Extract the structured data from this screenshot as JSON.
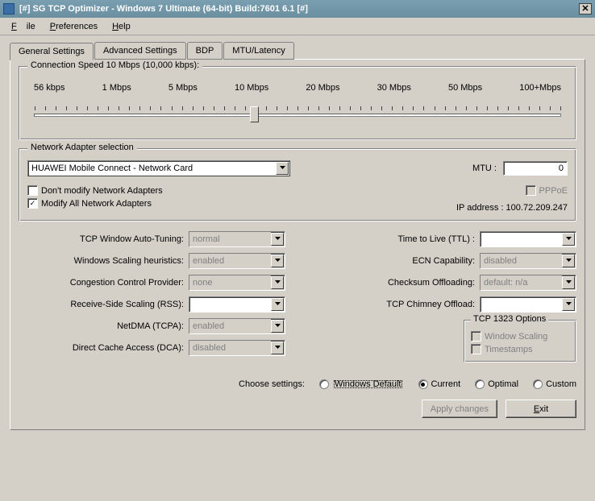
{
  "title": "[#] SG TCP Optimizer - Windows 7 Ultimate (64-bit) Build:7601 6.1  [#]",
  "menu": {
    "file": "File",
    "preferences": "Preferences",
    "help": "Help"
  },
  "tabs": {
    "general": "General Settings",
    "advanced": "Advanced Settings",
    "bdp": "BDP",
    "mtu": "MTU/Latency"
  },
  "connection": {
    "group_label": "Connection Speed  10 Mbps (10,000 kbps):",
    "ticks": [
      "56 kbps",
      "1 Mbps",
      "5 Mbps",
      "10 Mbps",
      "20 Mbps",
      "30 Mbps",
      "50 Mbps",
      "100+Mbps"
    ]
  },
  "adapter": {
    "group_label": "Network Adapter selection",
    "selected": "HUAWEI Mobile Connect - Network Card",
    "mtu_label": "MTU :",
    "mtu_value": "0",
    "chk_dont_modify": "Don't modify Network Adapters",
    "chk_modify_all": "Modify All Network Adapters",
    "pppoe": "PPPoE",
    "ip_label": "IP address : 100.72.209.247"
  },
  "settings_left": [
    {
      "label": "TCP Window Auto-Tuning:",
      "value": "normal",
      "disabled": true
    },
    {
      "label": "Windows Scaling heuristics:",
      "value": "enabled",
      "disabled": true
    },
    {
      "label": "Congestion Control Provider:",
      "value": "none",
      "disabled": true
    },
    {
      "label": "Receive-Side Scaling (RSS):",
      "value": "",
      "disabled": false
    },
    {
      "label": "NetDMA (TCPA):",
      "value": "enabled",
      "disabled": true
    },
    {
      "label": "Direct Cache Access (DCA):",
      "value": "disabled",
      "disabled": true
    }
  ],
  "settings_right": [
    {
      "label": "Time to Live (TTL) :",
      "value": "",
      "disabled": false
    },
    {
      "label": "ECN Capability:",
      "value": "disabled",
      "disabled": true
    },
    {
      "label": "Checksum Offloading:",
      "value": "default: n/a",
      "disabled": true
    },
    {
      "label": "TCP Chimney Offload:",
      "value": "",
      "disabled": false
    }
  ],
  "tcp1323": {
    "group": "TCP 1323 Options",
    "window_scaling": "Window Scaling",
    "timestamps": "Timestamps"
  },
  "choose": {
    "label": "Choose settings:",
    "windows_default": "Windows Default",
    "current": "Current",
    "optimal": "Optimal",
    "custom": "Custom"
  },
  "buttons": {
    "apply": "Apply changes",
    "exit": "Exit"
  }
}
